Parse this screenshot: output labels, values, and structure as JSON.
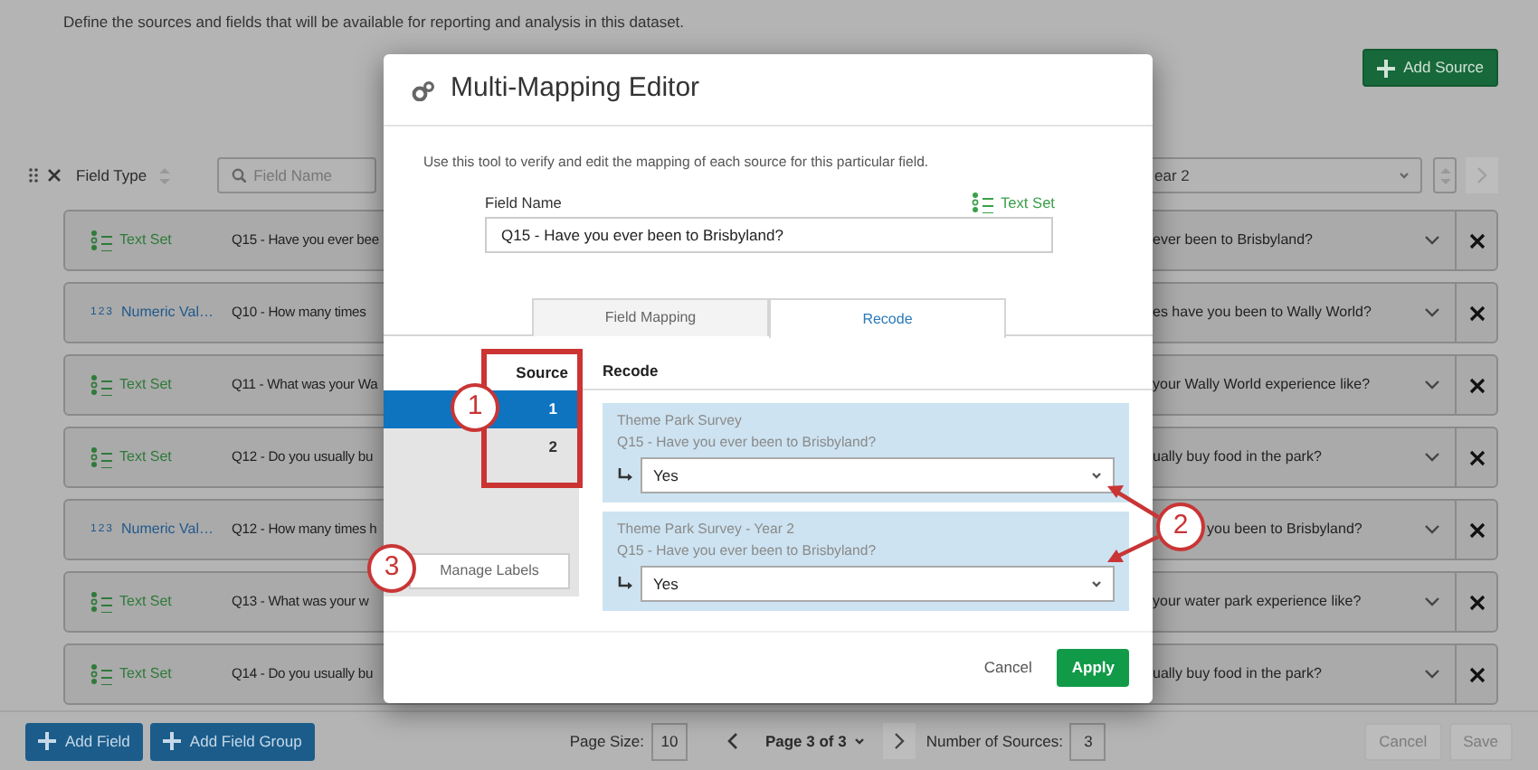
{
  "page": {
    "description": "Define the sources and fields that will be available for reporting and analysis in this dataset.",
    "add_source_button": "Add Source"
  },
  "toolbar": {
    "field_type_label": "Field Type",
    "search_placeholder": "Field Name",
    "source_select": "ear 2"
  },
  "fields": [
    {
      "kind": "text_set",
      "type_label": "Text Set",
      "question_start": "Q15 - Have you ever bee",
      "question_end": "ever been to Brisbyland?"
    },
    {
      "kind": "numeric",
      "icon_text": "123",
      "type_label": "Numeric Val…",
      "question_start": "Q10 - How many times",
      "question_end": "es have you been to Wally World?"
    },
    {
      "kind": "text_set",
      "type_label": "Text Set",
      "question_start": "Q11 - What was your Wa",
      "question_end": "your Wally World experience like?"
    },
    {
      "kind": "text_set",
      "type_label": "Text Set",
      "question_start": "Q12 - Do you usually bu",
      "question_end": "ually buy food in the park?"
    },
    {
      "kind": "numeric",
      "icon_text": "123",
      "type_label": "Numeric Val…",
      "question_start": "Q12 - How many times h",
      "question_end": "you been to Brisbyland?"
    },
    {
      "kind": "text_set",
      "type_label": "Text Set",
      "question_start": "Q13 - What was your w",
      "question_end": "your water park experience like?"
    },
    {
      "kind": "text_set",
      "type_label": "Text Set",
      "question_start": "Q14 - Do you usually bu",
      "question_end": "ually buy food in the park?"
    }
  ],
  "footer": {
    "add_field_button": "Add Field",
    "add_field_group_button": "Add Field Group",
    "page_size_label": "Page Size:",
    "page_size": "10",
    "page_label": "Page 3 of 3",
    "sources_label": "Number of Sources:",
    "sources_count": "3",
    "cancel_button": "Cancel",
    "save_button": "Save"
  },
  "modal": {
    "title": "Multi-Mapping Editor",
    "description": "Use this tool to verify and edit the mapping of each source for this particular field.",
    "field_name_label": "Field Name",
    "field_type": "Text Set",
    "field_name_value": "Q15 - Have you ever been to Brisbyland?",
    "tabs": [
      {
        "label": "Field Mapping",
        "selected": false
      },
      {
        "label": "Recode",
        "selected": true
      }
    ],
    "source_header": "Source",
    "sources": [
      {
        "label": "1",
        "selected": true
      },
      {
        "label": "2",
        "selected": false
      }
    ],
    "manage_labels_button": "Manage Labels",
    "recode_header": "Recode",
    "recodes": [
      {
        "survey": "Theme Park Survey",
        "question": "Q15 - Have you ever been to Brisbyland?",
        "value": "Yes"
      },
      {
        "survey": "Theme Park Survey - Year 2",
        "question": "Q15 - Have you ever been to Brisbyland?",
        "value": "Yes"
      }
    ],
    "cancel_button": "Cancel",
    "apply_button": "Apply"
  },
  "annotations": [
    {
      "label": "1"
    },
    {
      "label": "2"
    },
    {
      "label": "3"
    }
  ]
}
